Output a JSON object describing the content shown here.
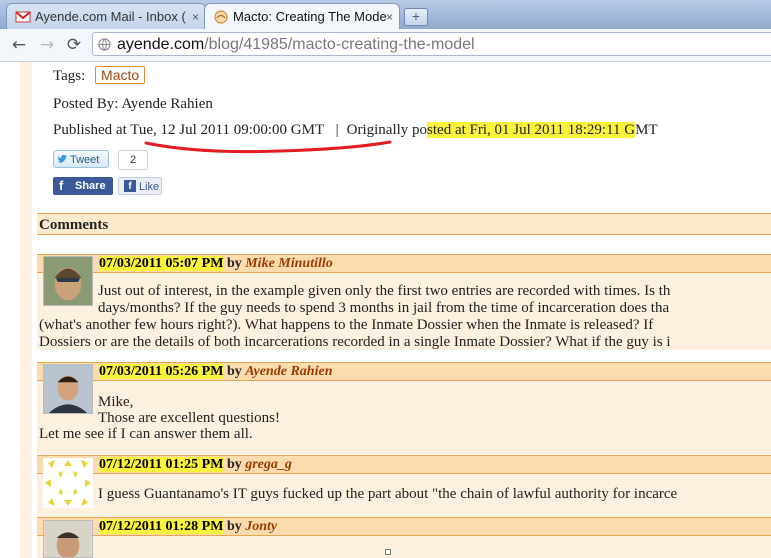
{
  "browser": {
    "tabs": [
      {
        "title": "Ayende.com Mail - Inbox (",
        "active": false
      },
      {
        "title": "Macto: Creating The Mode",
        "active": true
      }
    ],
    "address": {
      "host": "ayende.com",
      "path": "/blog/41985/macto-creating-the-model"
    }
  },
  "post": {
    "tags_label": "Tags:",
    "tag": "Macto",
    "posted_by": "Posted By: Ayende Rahien",
    "published_label": "Published at",
    "published_date": "Tue, 12 Jul 2011 09:00:00 GMT",
    "separator": "|",
    "originally_prefix": "Originally po",
    "originally_highlight": "sted at Fri, 01 Jul 2011 18:29:11 G",
    "originally_suffix": "MT"
  },
  "social": {
    "tweet": "Tweet",
    "tweet_count": "2",
    "share": "Share",
    "like": "Like"
  },
  "comments": {
    "header": "Comments",
    "items": [
      {
        "date": "07/03/2011 05:07 PM",
        "by": "by",
        "author": "Mike Minutillo",
        "lines": [
          "Just out of interest, in the example given only the first two entries are recorded with times. Is th",
          "days/months? If the guy needs to spend 3 months in jail from the time of incarceration does tha",
          "(what's another few hours right?). What happens to the Inmate Dossier when the Inmate is released? If",
          "Dossiers or are the details of both incarcerations recorded in a single Inmate Dossier? What if the guy is i"
        ]
      },
      {
        "date": "07/03/2011 05:26 PM",
        "by": "by",
        "author": "Ayende Rahien",
        "lines": [
          "Mike,",
          "Those are excellent questions!",
          "Let me see if I can answer them all."
        ]
      },
      {
        "date": "07/12/2011 01:25 PM",
        "by": "by",
        "author": "grega_g",
        "lines": [
          "I guess Guantanamo's IT guys fucked up the part about \"the chain of lawful authority for incarce"
        ]
      },
      {
        "date": "07/12/2011 01:28 PM",
        "by": "by",
        "author": "Jonty",
        "lines": []
      }
    ]
  },
  "colors": {
    "highlight": "#fbf23c",
    "annotation": "#e31b23",
    "comment_bg": "#fdf0de",
    "comment_head": "#fcdcae",
    "author": "#9a3b00"
  }
}
